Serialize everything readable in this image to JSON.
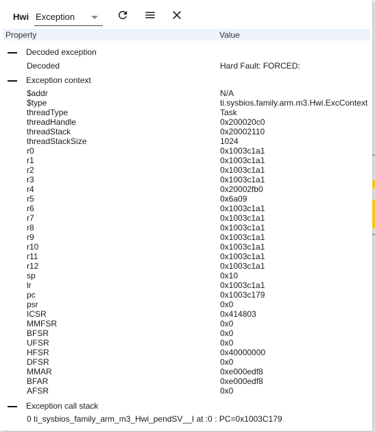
{
  "toolbar": {
    "title": "Hwi",
    "view_select": "Exception",
    "icons": [
      "refresh-icon",
      "menu-icon",
      "close-icon"
    ]
  },
  "table": {
    "headers": [
      "Property",
      "Value"
    ]
  },
  "groups": {
    "decoded_exception": {
      "label": "Decoded exception",
      "rows": [
        {
          "prop": "Decoded",
          "value": "Hard Fault: FORCED:"
        }
      ]
    },
    "exception_context": {
      "label": "Exception context",
      "rows": [
        {
          "prop": "$addr",
          "value": "N/A"
        },
        {
          "prop": "$type",
          "value": "ti.sysbios.family.arm.m3.Hwi.ExcContext"
        },
        {
          "prop": "threadType",
          "value": "Task"
        },
        {
          "prop": "threadHandle",
          "value": "0x200020c0"
        },
        {
          "prop": "threadStack",
          "value": "0x20002110"
        },
        {
          "prop": "threadStackSize",
          "value": "1024"
        },
        {
          "prop": "r0",
          "value": "0x1003c1a1"
        },
        {
          "prop": "r1",
          "value": "0x1003c1a1"
        },
        {
          "prop": "r2",
          "value": "0x1003c1a1"
        },
        {
          "prop": "r3",
          "value": "0x1003c1a1"
        },
        {
          "prop": "r4",
          "value": "0x20002fb0"
        },
        {
          "prop": "r5",
          "value": "0x6a09"
        },
        {
          "prop": "r6",
          "value": "0x1003c1a1"
        },
        {
          "prop": "r7",
          "value": "0x1003c1a1"
        },
        {
          "prop": "r8",
          "value": "0x1003c1a1"
        },
        {
          "prop": "r9",
          "value": "0x1003c1a1"
        },
        {
          "prop": "r10",
          "value": "0x1003c1a1"
        },
        {
          "prop": "r11",
          "value": "0x1003c1a1"
        },
        {
          "prop": "r12",
          "value": "0x1003c1a1"
        },
        {
          "prop": "sp",
          "value": "0x10"
        },
        {
          "prop": "lr",
          "value": "0x1003c1a1"
        },
        {
          "prop": "pc",
          "value": "0x1003c179"
        },
        {
          "prop": "psr",
          "value": "0x0"
        },
        {
          "prop": "ICSR",
          "value": "0x414803"
        },
        {
          "prop": "MMFSR",
          "value": "0x0"
        },
        {
          "prop": "BFSR",
          "value": "0x0"
        },
        {
          "prop": "UFSR",
          "value": "0x0"
        },
        {
          "prop": "HFSR",
          "value": "0x40000000"
        },
        {
          "prop": "DFSR",
          "value": "0x0"
        },
        {
          "prop": "MMAR",
          "value": "0xe000edf8"
        },
        {
          "prop": "BFAR",
          "value": "0xe000edf8"
        },
        {
          "prop": "AFSR",
          "value": "0x0"
        }
      ]
    },
    "call_stack": {
      "label": "Exception call stack",
      "entry": "0 ti_sysbios_family_arm_m3_Hwi_pendSV__I at :0 : PC=0x1003C179"
    }
  },
  "colors": {
    "header_bg": "#eef3fb",
    "underlay_highlight": "#f5c518"
  }
}
